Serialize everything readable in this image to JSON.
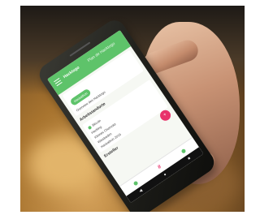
{
  "app": {
    "title": "Hacktogo",
    "subtitle": "Plan de Hacktogo",
    "primary_button": "Hackathon",
    "intro_text": "Overview des Hacktogo",
    "section_title": "Arbeitstandorte",
    "entry_lines": [
      "Bitcoin",
      "Hacking",
      "Kleines Chemnitz",
      "Wiesbaden",
      "Hackathon 2016"
    ],
    "bottom_label": "Ersteller",
    "fab_symbol": "+",
    "nav_hash": "#"
  },
  "colors": {
    "app_green": "#5ec36a",
    "accent_pink": "#e8336b"
  },
  "icons": [
    "menu-icon",
    "plus-icon",
    "hash-icon",
    "back-icon",
    "home-icon",
    "recents-icon"
  ]
}
